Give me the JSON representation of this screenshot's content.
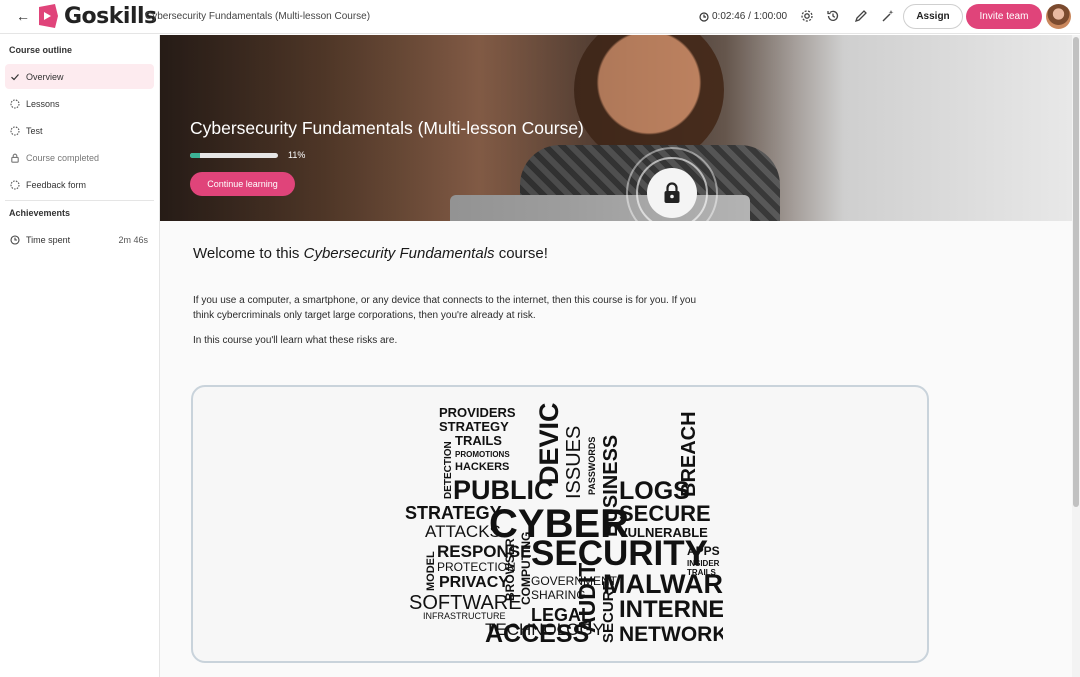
{
  "header": {
    "logo_text": "Goskills",
    "course_title": "Cybersecurity Fundamentals (Multi-lesson Course)",
    "timer": "0:02:46 / 1:00:00",
    "assign_label": "Assign",
    "invite_label": "Invite team",
    "accent_color": "#e0447a"
  },
  "sidebar": {
    "outline_heading": "Course outline",
    "items": [
      {
        "label": "Overview",
        "icon": "check-icon",
        "active": true
      },
      {
        "label": "Lessons",
        "icon": "dashed-circle-icon"
      },
      {
        "label": "Test",
        "icon": "dashed-circle-icon"
      },
      {
        "label": "Course completed",
        "icon": "lock-icon"
      },
      {
        "label": "Feedback form",
        "icon": "dashed-circle-icon"
      }
    ],
    "achievements_heading": "Achievements",
    "time_spent_label": "Time spent",
    "time_spent_value": "2m 46s"
  },
  "hero": {
    "title": "Cybersecurity Fundamentals (Multi-lesson Course)",
    "progress_percent": 11,
    "progress_label": "11%",
    "continue_label": "Continue learning"
  },
  "main": {
    "welcome_prefix": "Welcome to this ",
    "welcome_course": "Cybersecurity Fundamentals",
    "welcome_suffix": " course!",
    "para1": "If you use a computer, a smartphone, or any device that connects to the internet, then this course is for you. If you think cybercriminals only target large corporations, then you're already at risk.",
    "para2": "In this course you'll learn what these risks are."
  },
  "word_cloud": {
    "words": [
      "PROVIDERS",
      "STRATEGY",
      "TRAILS",
      "PROMOTIONS",
      "HACKERS",
      "DETECTION",
      "PUBLIC",
      "DEVICE",
      "ISSUES",
      "PASSWORDS",
      "BUSINESS",
      "LOGS",
      "BREACH",
      "STRATEGY",
      "ATTACKS",
      "CYBER",
      "SECURE",
      "VULNERABLE",
      "MODEL",
      "RESPONSE",
      "PROTECTION",
      "PRIVACY",
      "BROWSER",
      "COMPUTING",
      "SECURITY",
      "APPS",
      "INSIDER",
      "TRAILS",
      "GOVERNMENT",
      "SOFTWARE",
      "INFRASTRUCTURE",
      "SHARING",
      "LEGAL",
      "MALWARE",
      "AUDIT",
      "SECURE",
      "INTERNET",
      "TECHNOLOGY",
      "ACCESS",
      "NETWORK"
    ]
  }
}
